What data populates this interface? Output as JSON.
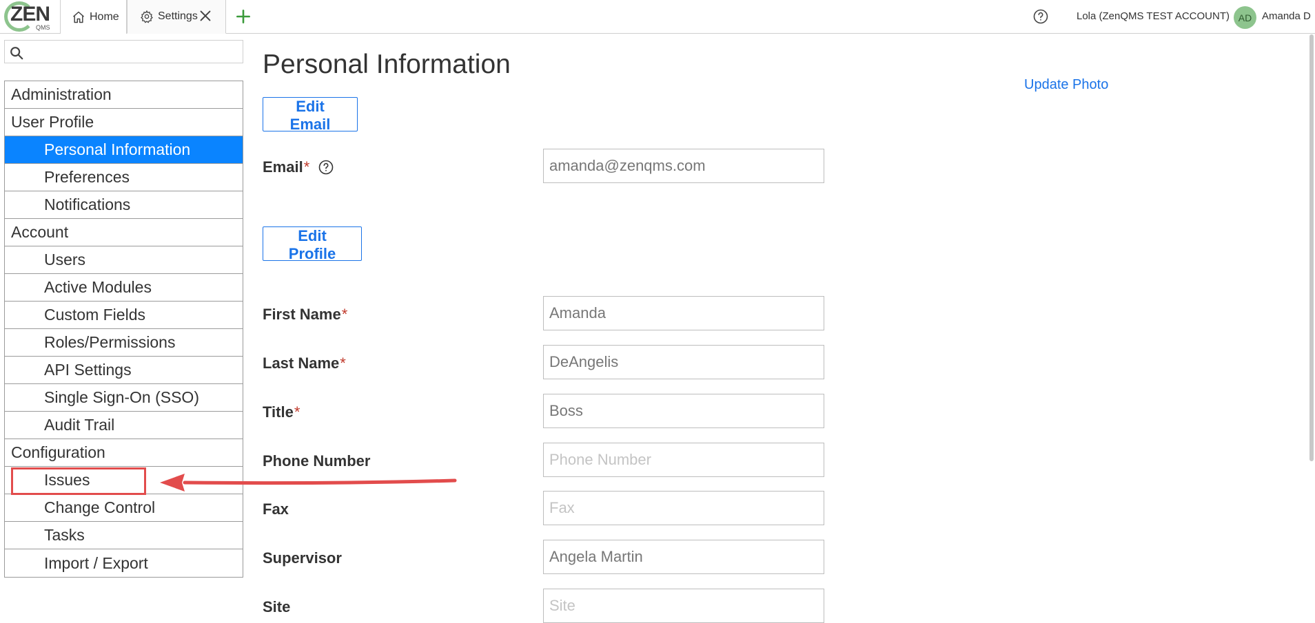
{
  "header": {
    "logo_text": "ZEN",
    "logo_sub": "QMS",
    "tabs": [
      {
        "label": "Home",
        "icon": "home-icon"
      },
      {
        "label": "Settings",
        "icon": "gear-icon",
        "close_icon": "close-icon"
      }
    ],
    "add_tab_icon": "plus-icon",
    "help_icon": "help-icon",
    "account": "Lola (ZenQMS TEST ACCOUNT)",
    "avatar_initials": "AD",
    "user": "Amanda D"
  },
  "sidebar": {
    "search_placeholder": "",
    "items": [
      {
        "label": "Administration",
        "level": 0
      },
      {
        "label": "User Profile",
        "level": 0
      },
      {
        "label": "Personal Information",
        "level": 1,
        "active": true
      },
      {
        "label": "Preferences",
        "level": 1
      },
      {
        "label": "Notifications",
        "level": 1
      },
      {
        "label": "Account",
        "level": 0
      },
      {
        "label": "Users",
        "level": 1
      },
      {
        "label": "Active Modules",
        "level": 1
      },
      {
        "label": "Custom Fields",
        "level": 1
      },
      {
        "label": "Roles/Permissions",
        "level": 1
      },
      {
        "label": "API Settings",
        "level": 1
      },
      {
        "label": "Single Sign-On (SSO)",
        "level": 1
      },
      {
        "label": "Audit Trail",
        "level": 1
      },
      {
        "label": "Configuration",
        "level": 0
      },
      {
        "label": "Issues",
        "level": 1,
        "highlighted": true
      },
      {
        "label": "Change Control",
        "level": 1
      },
      {
        "label": "Tasks",
        "level": 1
      },
      {
        "label": "Import / Export",
        "level": 1
      }
    ]
  },
  "main": {
    "title": "Personal Information",
    "update_photo": "Update Photo",
    "edit_email": "Edit Email",
    "edit_profile": "Edit Profile",
    "required_mark": "*",
    "email": {
      "label": "Email",
      "value": "amanda@zenqms.com"
    },
    "fields": [
      {
        "label": "First Name",
        "required": true,
        "value": "Amanda",
        "placeholder": ""
      },
      {
        "label": "Last Name",
        "required": true,
        "value": "DeAngelis",
        "placeholder": ""
      },
      {
        "label": "Title",
        "required": true,
        "value": "Boss",
        "placeholder": ""
      },
      {
        "label": "Phone Number",
        "required": false,
        "value": "",
        "placeholder": "Phone Number"
      },
      {
        "label": "Fax",
        "required": false,
        "value": "",
        "placeholder": "Fax"
      },
      {
        "label": "Supervisor",
        "required": false,
        "value": "Angela Martin",
        "placeholder": ""
      },
      {
        "label": "Site",
        "required": false,
        "value": "",
        "placeholder": "Site"
      }
    ]
  },
  "colors": {
    "accent": "#0a84ff",
    "link": "#1a73e8",
    "annotation": "#e24c4c",
    "avatar": "#8dc48d"
  }
}
